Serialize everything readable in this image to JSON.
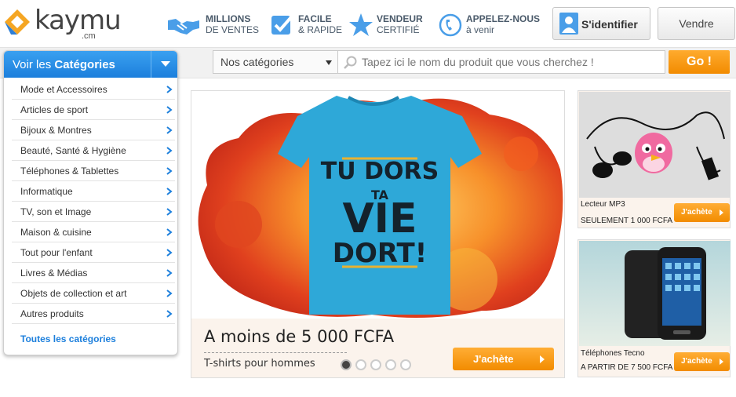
{
  "brand": {
    "name": "kaymu",
    "domain": ".cm",
    "color": "#f5a623"
  },
  "features": [
    {
      "icon": "handshake-icon",
      "line1": "MILLIONS",
      "line2": "DE VENTES"
    },
    {
      "icon": "checkbox-icon",
      "line1": "FACILE",
      "line2": "& RAPIDE"
    },
    {
      "icon": "star-icon",
      "line1": "VENDEUR",
      "line2": "CERTIFIÉ"
    },
    {
      "icon": "phone-icon",
      "line1": "APPELEZ-NOUS",
      "line2": "à venir"
    }
  ],
  "header": {
    "login_label": "S'identifier",
    "sell_label": "Vendre"
  },
  "categories": {
    "head_prefix": "Voir les",
    "head_bold": "Catégories",
    "items": [
      "Mode et Accessoires",
      "Articles de sport",
      "Bijoux & Montres",
      "Beauté, Santé & Hygiène",
      "Téléphones & Tablettes",
      "Informatique",
      "TV, son et Image",
      "Maison & cuisine",
      "Tout pour l'enfant",
      "Livres & Médias",
      "Objets de collection et art",
      "Autres produits"
    ],
    "all_label": "Toutes les catégories"
  },
  "search": {
    "category_value": "Nos catégories",
    "placeholder": "Tapez ici le nom du produit que vous cherchez !",
    "go_label": "Go !"
  },
  "hero": {
    "title": "A moins de 5 000 FCFA",
    "subtitle": "T-shirts pour hommes",
    "button": "J'achète",
    "shirt_text": [
      "TU DORS",
      "TA",
      "VIE",
      "DORT!"
    ],
    "slides": 5,
    "active_slide": 1
  },
  "promos": [
    {
      "name": "Lecteur MP3",
      "price": "SEULEMENT 1 000 FCFA",
      "button": "J'achète"
    },
    {
      "name": "Téléphones Tecno",
      "price": "A PARTIR DE 7 500 FCFA",
      "button": "J'achète"
    }
  ],
  "colors": {
    "accent": "#1c7fdc",
    "orange": "#f28c00",
    "shirt": "#2ea8d8"
  }
}
